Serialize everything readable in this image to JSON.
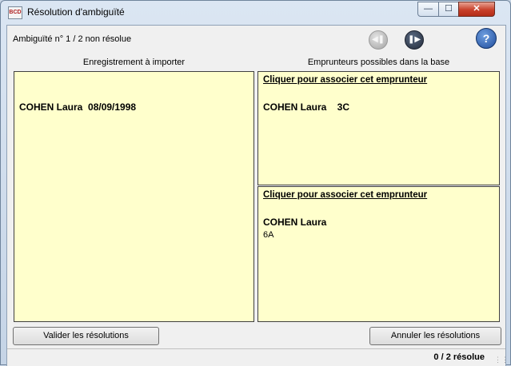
{
  "window": {
    "title": "Résolution d'ambiguïté",
    "icon": "app-icon",
    "controls": {
      "minimize": "—",
      "maximize": "☐",
      "close": "✕"
    }
  },
  "header": {
    "ambiguity_status": "Ambiguïté n° 1 / 2 non résolue",
    "prev_icon": "previous-icon",
    "next_icon": "next-icon",
    "help_icon": "help-icon"
  },
  "columns": {
    "left_title": "Enregistrement à importer",
    "right_title": "Emprunteurs possibles dans la base"
  },
  "import_record": {
    "name": "COHEN Laura  08/09/1998"
  },
  "candidates": [
    {
      "link_text": "Cliquer pour associer cet emprunteur",
      "name": "COHEN Laura    3C",
      "class": ""
    },
    {
      "link_text": "Cliquer pour associer cet emprunteur",
      "name": "COHEN Laura",
      "class": "6A"
    }
  ],
  "footer": {
    "validate_label": "Valider les résolutions",
    "cancel_label": "Annuler les résolutions",
    "status": "0 / 2 résolue"
  }
}
